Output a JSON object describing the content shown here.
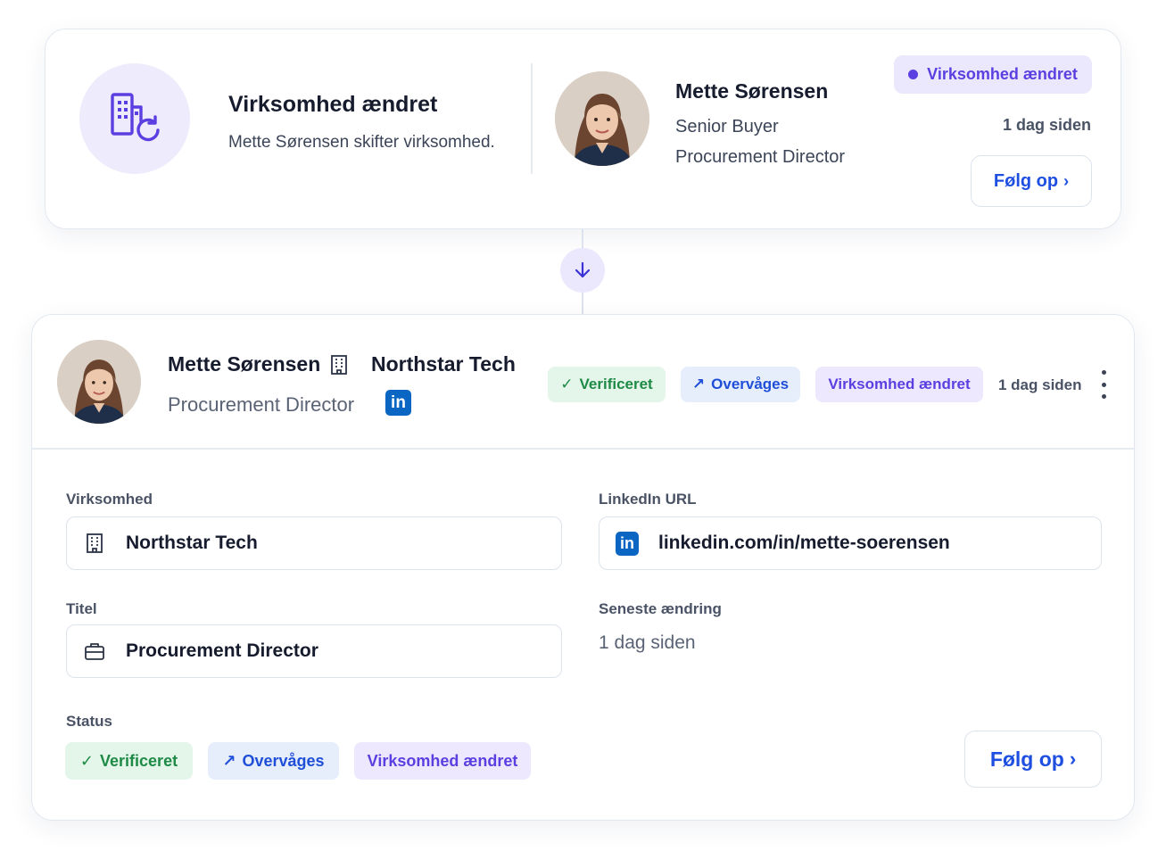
{
  "event": {
    "title": "Virksomhed ændret",
    "description": "Mette Sørensen skifter virksomhed.",
    "icon": "building-refresh-icon"
  },
  "top_person": {
    "name": "Mette Sørensen",
    "role_old": "Senior Buyer",
    "role_new": "Procurement Director",
    "badge": "Virksomhed ændret",
    "time": "1 dag siden",
    "follow_label": "Følg op"
  },
  "detail": {
    "name": "Mette Sørensen",
    "company": "Northstar Tech",
    "title": "Procurement Director",
    "linkedin_logo": "in",
    "header_pills": {
      "verified": "Verificeret",
      "watched": "Overvåges",
      "changed": "Virksomhed ændret"
    },
    "time": "1 dag siden",
    "fields": {
      "company_label": "Virksomhed",
      "company_value": "Northstar Tech",
      "linkedin_label": "LinkedIn URL",
      "linkedin_value": "linkedin.com/in/mette-soerensen",
      "title_label": "Titel",
      "title_value": "Procurement Director",
      "latest_label": "Seneste ændring",
      "latest_value": "1 dag siden"
    },
    "status": {
      "label": "Status",
      "verified": "Verificeret",
      "watched": "Overvåges",
      "changed": "Virksomhed ændret"
    },
    "follow_label": "Følg op"
  },
  "colors": {
    "accent_purple": "#5b3fe0",
    "accent_blue": "#1f4fe0",
    "success_green": "#1e8a46",
    "linkedin_blue": "#0a66c2"
  }
}
